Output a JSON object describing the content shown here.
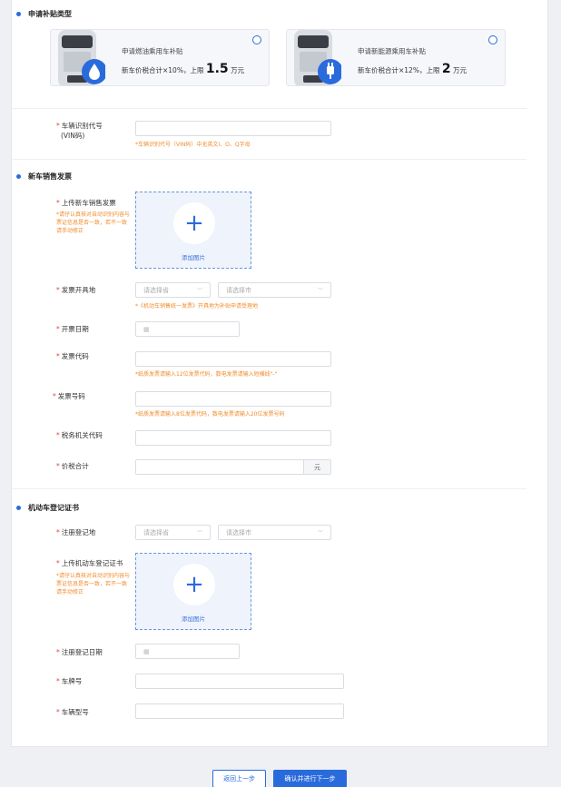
{
  "sections": {
    "subsidy_type": "申请补贴类型",
    "invoice": "新车销售发票",
    "registration": "机动车登记证书"
  },
  "cards": [
    {
      "title": "申请燃油乘用车补贴",
      "desc_prefix": "新车价税合计×10%，上限",
      "amount": "1.5",
      "unit": "万元"
    },
    {
      "title": "申请新能源乘用车补贴",
      "desc_prefix": "新车价税合计×12%，上限",
      "amount": "2",
      "unit": "万元"
    }
  ],
  "vin": {
    "label_line1": "车辆识别代号",
    "label_line2": "(VIN码)",
    "hint": "*车辆识别代号（VIN码）中无英文I、O、Q字母"
  },
  "invoice_upload": {
    "label": "上传新车销售发票",
    "hint": "*请仔认真核对自动识别内容与票证信息是否一致，若不一致请手动修正",
    "button": "添加图片"
  },
  "invoice_place": {
    "label": "发票开具地",
    "province_placeholder": "请选择省",
    "city_placeholder": "请选择市",
    "hint": "*《机动车销售统一发票》开具地为补贴申请受理地"
  },
  "invoice_date": {
    "label": "开票日期"
  },
  "invoice_code": {
    "label": "发票代码",
    "hint": "*纸质发票请输入12位发票代码，数电发票请输入短横线\"-\""
  },
  "invoice_number": {
    "label": "发票号码",
    "hint": "*纸质发票请输入8位发票代码，数电发票请输入20位发票号码"
  },
  "tax_office": {
    "label": "税务机关代码"
  },
  "total_price": {
    "label": "价税合计",
    "suffix": "元"
  },
  "reg_place": {
    "label": "注册登记地",
    "province_placeholder": "请选择省",
    "city_placeholder": "请选择市"
  },
  "reg_upload": {
    "label": "上传机动车登记证书",
    "hint": "*请仔认真核对自动识别内容与票证信息是否一致，若不一致请手动修正",
    "button": "添加图片"
  },
  "reg_date": {
    "label": "注册登记日期"
  },
  "plate": {
    "label": "车牌号"
  },
  "model": {
    "label": "车辆型号"
  },
  "buttons": {
    "back": "返回上一步",
    "next": "确认并进行下一步"
  },
  "required_mark": "*",
  "colors": {
    "primary": "#2a6bdc",
    "hint": "#f08c2a",
    "required": "#e2463f"
  }
}
